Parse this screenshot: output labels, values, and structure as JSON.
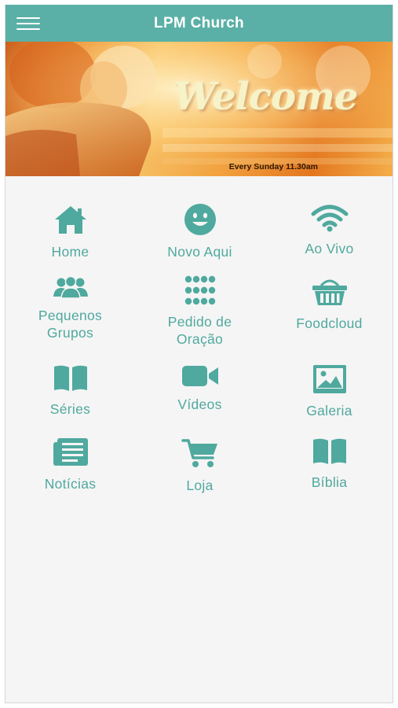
{
  "header": {
    "title": "LPM Church",
    "menu_icon": "hamburger-menu-icon"
  },
  "banner": {
    "headline": "Welcome",
    "subtitle": "Every Sunday 11.30am"
  },
  "theme": {
    "accent": "#5ab0a6",
    "icon_color": "#4fa99e",
    "background": "#f5f5f5"
  },
  "menu": {
    "items": [
      {
        "label": "Home",
        "icon": "home-icon"
      },
      {
        "label": "Novo Aqui",
        "icon": "smiley-icon"
      },
      {
        "label": "Ao Vivo",
        "icon": "wifi-icon"
      },
      {
        "label": "Pequenos\nGrupos",
        "icon": "group-icon"
      },
      {
        "label": "Pedido de\nOração",
        "icon": "keypad-icon"
      },
      {
        "label": "Foodcloud",
        "icon": "basket-icon"
      },
      {
        "label": "Séries",
        "icon": "book-icon"
      },
      {
        "label": "Vídeos",
        "icon": "video-camera-icon"
      },
      {
        "label": "Galeria",
        "icon": "image-gallery-icon"
      },
      {
        "label": "Notícias",
        "icon": "newspaper-icon"
      },
      {
        "label": "Loja",
        "icon": "shopping-cart-icon"
      },
      {
        "label": "Bíblia",
        "icon": "bible-icon"
      }
    ]
  }
}
